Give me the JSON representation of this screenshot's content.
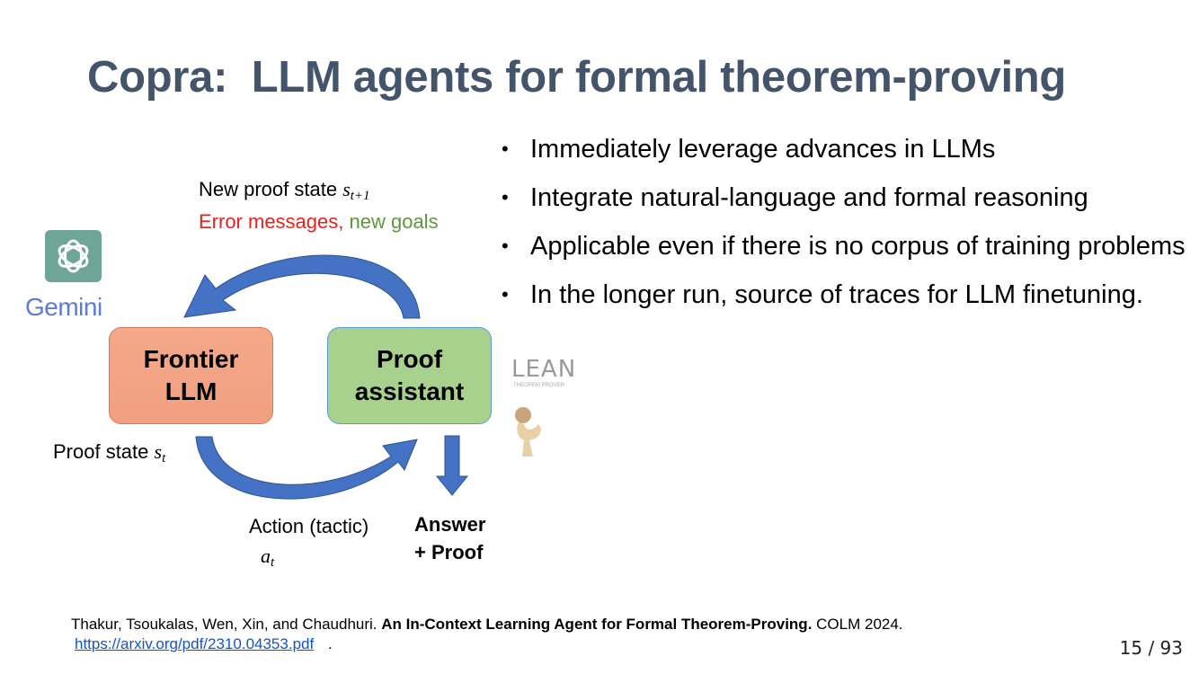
{
  "title": "Copra:  LLM agents for formal theorem-proving",
  "bullets": [
    "Immediately leverage advances in LLMs",
    "Integrate natural-language and formal reasoning",
    "Applicable even if there is no corpus of training problems",
    "In the longer run, source of traces for LLM finetuning."
  ],
  "bullet_symbol": "•",
  "diagram": {
    "llm_box_line1": "Frontier",
    "llm_box_line2": "LLM",
    "proof_box_line1": "Proof",
    "proof_box_line2": "assistant",
    "new_state_label": "New proof state ",
    "new_state_var": "s",
    "new_state_sub": "t+1",
    "error_label": "Error messages,",
    "goals_label": " new goals",
    "state_label": "Proof state ",
    "state_var": "s",
    "state_sub": "t",
    "action_label": "Action (tactic)",
    "action_var": "a",
    "action_sub": "t",
    "answer_line1": "Answer",
    "answer_line2": "+ Proof"
  },
  "logos": {
    "gemini": "Gemini",
    "lean": "LEAN",
    "lean_sub": "THEOREM PROVER",
    "chatgpt_icon": "chatgpt-logo-icon",
    "coq_icon": "coq-rooster-logo-icon"
  },
  "reference": {
    "authors": "Thakur,  Tsoukalas, Wen, Xin, and Chaudhuri. ",
    "paper_title": "An In-Context Learning Agent  for Formal Theorem-Proving.",
    "venue": " COLM 2024.",
    "url": "https://arxiv.org/pdf/2310.04353.pdf",
    "url_suffix": "."
  },
  "pager": "15 / 93",
  "colors": {
    "title": "#44546a",
    "arrow": "#4472c4",
    "llm_box": "#f4a98a",
    "proof_box": "#a9d18e",
    "error_text": "#e8211b",
    "goals_text": "#5a9a3a",
    "link": "#1155cc"
  }
}
